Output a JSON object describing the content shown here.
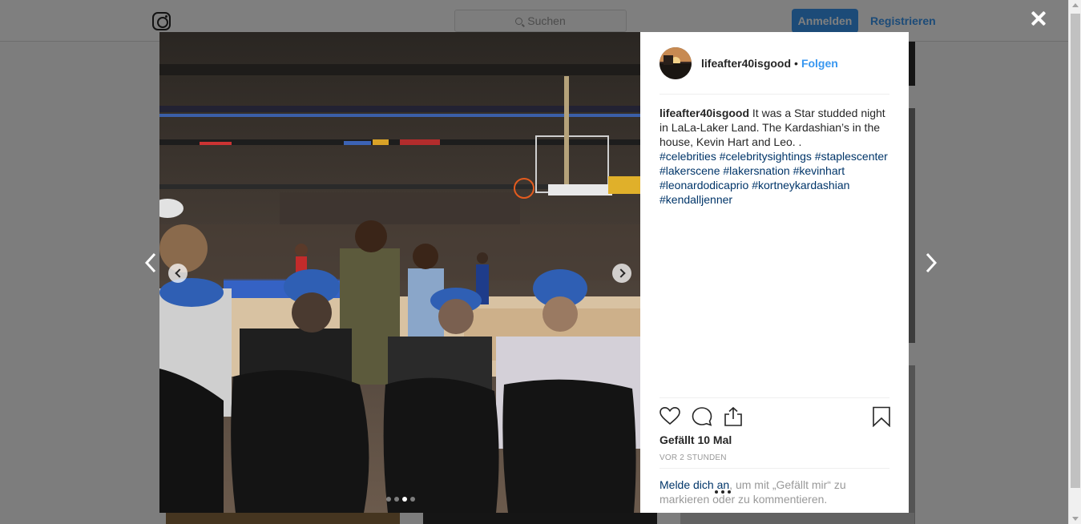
{
  "header": {
    "search_placeholder": "Suchen",
    "login_label": "Anmelden",
    "register_label": "Registrieren"
  },
  "post": {
    "username": "lifeafter40isgood",
    "separator": "•",
    "follow_label": "Folgen",
    "caption_text": "It was a Star studded night in LaLa-Laker Land. The Kardashian’s in the house, Kevin Hart and Leo. .",
    "hashtags": [
      "#celebrities",
      "#celebritysightings",
      "#staplescenter",
      "#lakerscene",
      "#lakersnation",
      "#kevinhart",
      "#leonardodicaprio",
      "#kortneykardashian",
      "#kendalljenner"
    ],
    "likes_text": "Gefällt 10 Mal",
    "time_text": "VOR 2 STUNDEN",
    "login_prompt_link": "Melde dich an",
    "login_prompt_rest": ", um mit „Gefällt mir“ zu markieren oder zu kommentieren.",
    "carousel_count": 4,
    "carousel_active_index": 2
  },
  "colors": {
    "accent": "#3897f0",
    "hashtag": "#003569"
  },
  "icons": {
    "close": "close-icon",
    "prev": "chevron-left-icon",
    "next": "chevron-right-icon",
    "like": "heart-icon",
    "comment": "comment-icon",
    "share": "share-icon",
    "save": "bookmark-icon",
    "more": "more-icon"
  }
}
